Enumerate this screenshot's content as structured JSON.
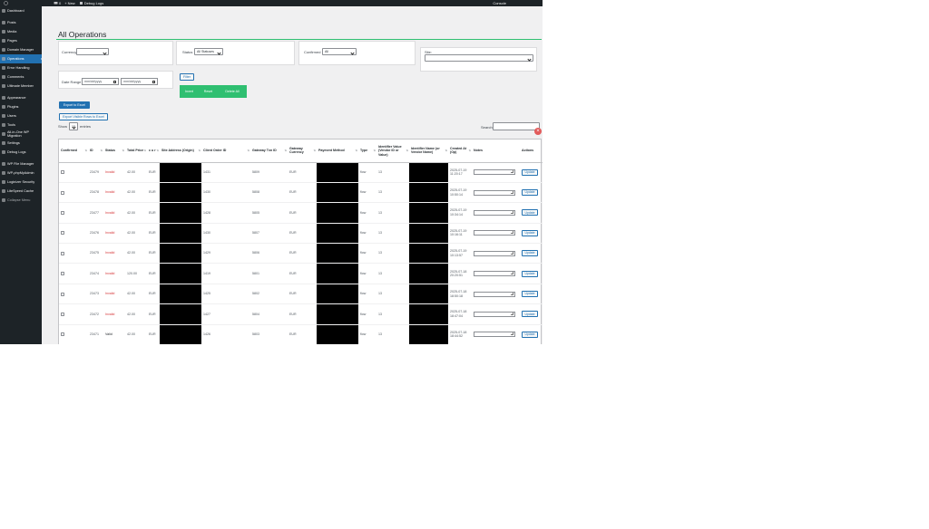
{
  "admin_bar": {
    "wp_logo": "wordpress-icon",
    "updates_count": "0",
    "new_label": "+ New",
    "debug_logs_label": "Debug Logs",
    "console_label": "Console"
  },
  "sidebar": {
    "items": [
      {
        "label": "Dashboard",
        "icon": "dashboard-icon"
      },
      {
        "label": "Posts",
        "icon": "posts-icon"
      },
      {
        "label": "Media",
        "icon": "media-icon"
      },
      {
        "label": "Pages",
        "icon": "pages-icon"
      },
      {
        "label": "Domain Manager",
        "icon": "domain-icon"
      },
      {
        "label": "Operations",
        "icon": "operations-icon",
        "active": true
      },
      {
        "label": "Error Handling",
        "icon": "error-icon"
      },
      {
        "label": "Comments",
        "icon": "comments-icon"
      },
      {
        "label": "Ultimate Member",
        "icon": "member-icon"
      },
      {
        "label": "Appearance",
        "icon": "appearance-icon"
      },
      {
        "label": "Plugins",
        "icon": "plugins-icon"
      },
      {
        "label": "Users",
        "icon": "users-icon"
      },
      {
        "label": "Tools",
        "icon": "tools-icon"
      },
      {
        "label": "All-in-One WP Migration",
        "icon": "migration-icon"
      },
      {
        "label": "Settings",
        "icon": "settings-icon"
      },
      {
        "label": "Debug Logs",
        "icon": "logs-icon"
      },
      {
        "label": "WP File Manager",
        "icon": "file-manager-icon"
      },
      {
        "label": "WP-phpMyAdmin",
        "icon": "database-icon"
      },
      {
        "label": "Loginizer Security",
        "icon": "security-icon"
      },
      {
        "label": "LiteSpeed Cache",
        "icon": "cache-icon"
      },
      {
        "label": "Collapse Menu",
        "icon": "collapse-icon"
      }
    ]
  },
  "page": {
    "title": "All Operations"
  },
  "filters": {
    "currency_label": "Currency",
    "currency_value": "",
    "status_label": "Status",
    "status_value": "All Statuses",
    "confirmed_label": "Confirmed",
    "confirmed_value": "All",
    "site_label": "Site:",
    "site_value": "",
    "date_range_label": "Date Range",
    "date_from_placeholder": "mm/dd/yyyy",
    "date_to_placeholder": "mm/dd/yyyy",
    "filter_button": "Filter",
    "invert_button": "Invert",
    "reset_button": "Reset",
    "delete_all_button": "Delete All"
  },
  "export": {
    "export_excel": "Export to Excel",
    "export_visible": "Export Visible Rows to Excel"
  },
  "table_controls": {
    "show_label": "Show",
    "entries_value": "10",
    "entries_label": "entries",
    "search_label": "Search:"
  },
  "table": {
    "headers": [
      "Confirmed",
      "ID",
      "Status",
      "Total Price",
      "c u r",
      "Site Address (Origin)",
      "Client Order ID",
      "Gateway Txn ID",
      "Gateway Currency",
      "Payment Method",
      "Type",
      "Identifier Value (Vendor ID or Value)",
      "Identifier Name (or Vendor Name)",
      "Created At (Op)",
      "Notes",
      "Actions"
    ],
    "update_label": "Update",
    "rows": [
      {
        "id": "23479",
        "status": "Invalid",
        "status_class": "st-invalid",
        "price": "42.00",
        "cur": "EUR",
        "client_order": "1431",
        "gateway_txn": "5809",
        "gw_currency": "EUR",
        "type": "flow",
        "ident_value": "13",
        "created": "2025-07-19 11:20:17"
      },
      {
        "id": "23478",
        "status": "Invalid",
        "status_class": "st-invalid",
        "price": "42.00",
        "cur": "EUR",
        "client_order": "1430",
        "gateway_txn": "5808",
        "gw_currency": "EUR",
        "type": "flow",
        "ident_value": "13",
        "created": "2025-07-19 10:50:14"
      },
      {
        "id": "23477",
        "status": "Invalid",
        "status_class": "st-invalid",
        "price": "42.00",
        "cur": "EUR",
        "client_order": "1428",
        "gateway_txn": "5805",
        "gw_currency": "EUR",
        "type": "flow",
        "ident_value": "13",
        "created": "2025-07-19 10:34:14"
      },
      {
        "id": "23476",
        "status": "Invalid",
        "status_class": "st-invalid",
        "price": "42.00",
        "cur": "EUR",
        "client_order": "1430",
        "gateway_txn": "5807",
        "gw_currency": "EUR",
        "type": "flow",
        "ident_value": "13",
        "created": "2025-07-19 10:16:11"
      },
      {
        "id": "23475",
        "status": "Invalid",
        "status_class": "st-invalid",
        "price": "42.00",
        "cur": "EUR",
        "client_order": "1429",
        "gateway_txn": "5806",
        "gw_currency": "EUR",
        "type": "flow",
        "ident_value": "13",
        "created": "2025-07-19 10:13:57"
      },
      {
        "id": "23474",
        "status": "Invalid",
        "status_class": "st-invalid",
        "price": "120.00",
        "cur": "EUR",
        "client_order": "1419",
        "gateway_txn": "5801",
        "gw_currency": "EUR",
        "type": "flow",
        "ident_value": "13",
        "created": "2025-07-18 20:20:51"
      },
      {
        "id": "23473",
        "status": "Invalid",
        "status_class": "st-invalid",
        "price": "42.00",
        "cur": "EUR",
        "client_order": "1425",
        "gateway_txn": "5802",
        "gw_currency": "EUR",
        "type": "flow",
        "ident_value": "13",
        "created": "2025-07-18 18:50:18"
      },
      {
        "id": "23472",
        "status": "Invalid",
        "status_class": "st-invalid",
        "price": "42.00",
        "cur": "EUR",
        "client_order": "1427",
        "gateway_txn": "5804",
        "gw_currency": "EUR",
        "type": "flow",
        "ident_value": "13",
        "created": "2025-07-18 18:47:04"
      },
      {
        "id": "23471",
        "status": "Valid",
        "status_class": "st-valid",
        "price": "42.00",
        "cur": "EUR",
        "client_order": "1426",
        "gateway_txn": "5803",
        "gw_currency": "EUR",
        "type": "flow",
        "ident_value": "13",
        "created": "2025-07-18 18:44:52"
      }
    ]
  },
  "colors": {
    "accent_green": "#2fbf71",
    "admin_blue": "#2271b1",
    "invalid_red": "#d63638",
    "sidebar_bg": "#1d2327"
  }
}
